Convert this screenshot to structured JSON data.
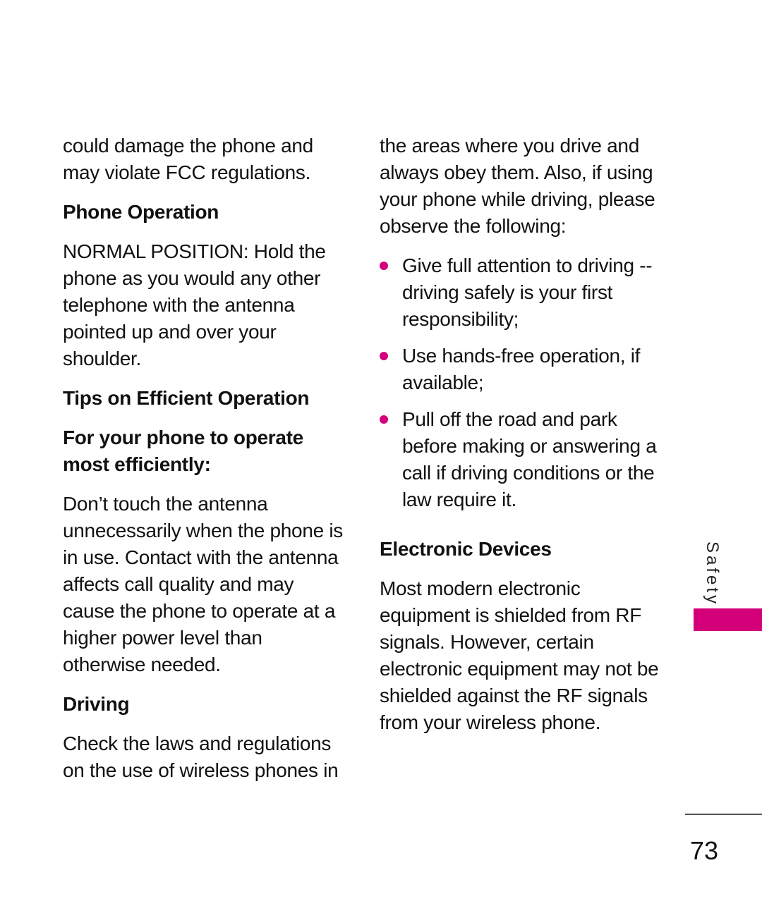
{
  "accent_color": "#d4007a",
  "left_column": {
    "intro": "could damage the phone and may violate FCC regulations.",
    "phone_operation": {
      "heading": "Phone Operation",
      "body": "NORMAL POSITION: Hold the phone as you would any other telephone with the antenna pointed up and over your shoulder."
    },
    "tips": {
      "heading": "Tips on Efficient Operation",
      "subheading": "For your phone to operate most efficiently:",
      "body": "Don’t touch the antenna unnecessarily when the phone is in use. Contact with the antenna affects call quality and may cause the phone to operate at a higher power level than otherwise needed."
    },
    "driving": {
      "heading": "Driving",
      "body": "Check the laws and regulations on the use of wireless phones in"
    }
  },
  "right_column": {
    "intro": "the areas where you drive and always obey them. Also, if using your phone while driving, please observe the following:",
    "bullets": [
      "Give full attention to driving -- driving safely is your first responsibility;",
      "Use hands-free operation, if available;",
      "Pull off the road and park before making or answering a call if driving conditions or the law require it."
    ],
    "electronic_devices": {
      "heading": "Electronic Devices",
      "body": "Most modern electronic equipment is shielded from RF signals. However, certain electronic equipment may not be shielded against the RF signals from your wireless phone."
    }
  },
  "side_tab": {
    "label": "Safety"
  },
  "page_number": "73"
}
